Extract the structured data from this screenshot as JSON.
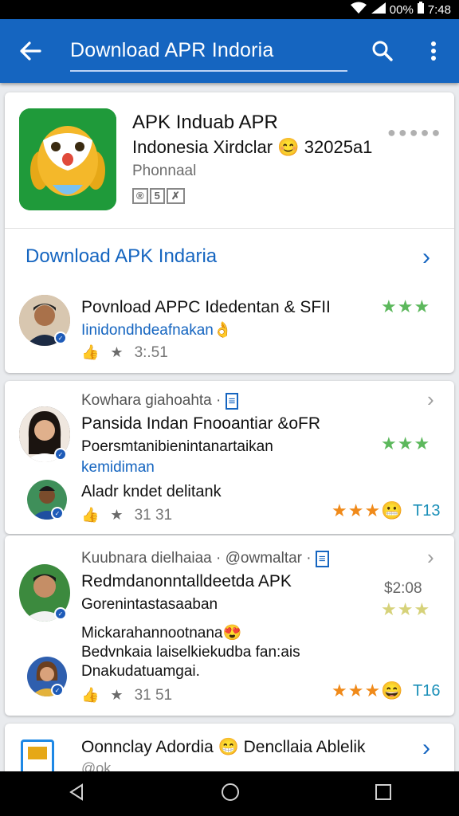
{
  "status_bar": {
    "battery": "00%",
    "time": "7:48"
  },
  "app_bar": {
    "search_text": "Download APR Indoria"
  },
  "app_card": {
    "title_line1": "APK Induab APR",
    "title_line2": "Indonesia Xirdclar",
    "title_emoji": "😊",
    "title_code": "32025a1",
    "developer": "Phonnaal",
    "badges": [
      "®",
      "5",
      "✗"
    ]
  },
  "download_row": {
    "label": "Download APK Indaria"
  },
  "review1": {
    "title": "Povnload APPC Idedentan & SFII",
    "subtitle": "Iinidondhdeafnakan",
    "emoji": "👌",
    "time": "3:.51"
  },
  "review2": {
    "author": "Kowhara giahoahta ·",
    "title": "Pansida Indan Fnooantiar &oFR",
    "body": "Poersmtanibienintanartaikan",
    "link": "kemidiman",
    "reply_text": "Aladr kndet delitank",
    "time": "31 31",
    "score": "T13"
  },
  "review3": {
    "author": "Kuubnara dielhaiaa · @owmaltar ·",
    "title": "Redmdanonntalldeetda APK",
    "body": "Gorenintastasaaban",
    "price": "$2:08",
    "reply_line1": "Mickarahannootnana",
    "reply_emoji": "😍",
    "reply_line2": "Bedvnkaia laiselkiekudba fan:ais",
    "reply_line3": "Dnakudatuamgai.",
    "time": "31 51",
    "score": "T16"
  },
  "bottom_card": {
    "title": "Oonnclay Adordia",
    "emoji": "😁",
    "title_tail": "Dencllaia Ablelik",
    "sub": "@ok"
  },
  "colors": {
    "app_bar": "#1565c0",
    "link": "#1565c0",
    "star_green": "#5cb85c",
    "star_orange": "#f08a1a"
  }
}
